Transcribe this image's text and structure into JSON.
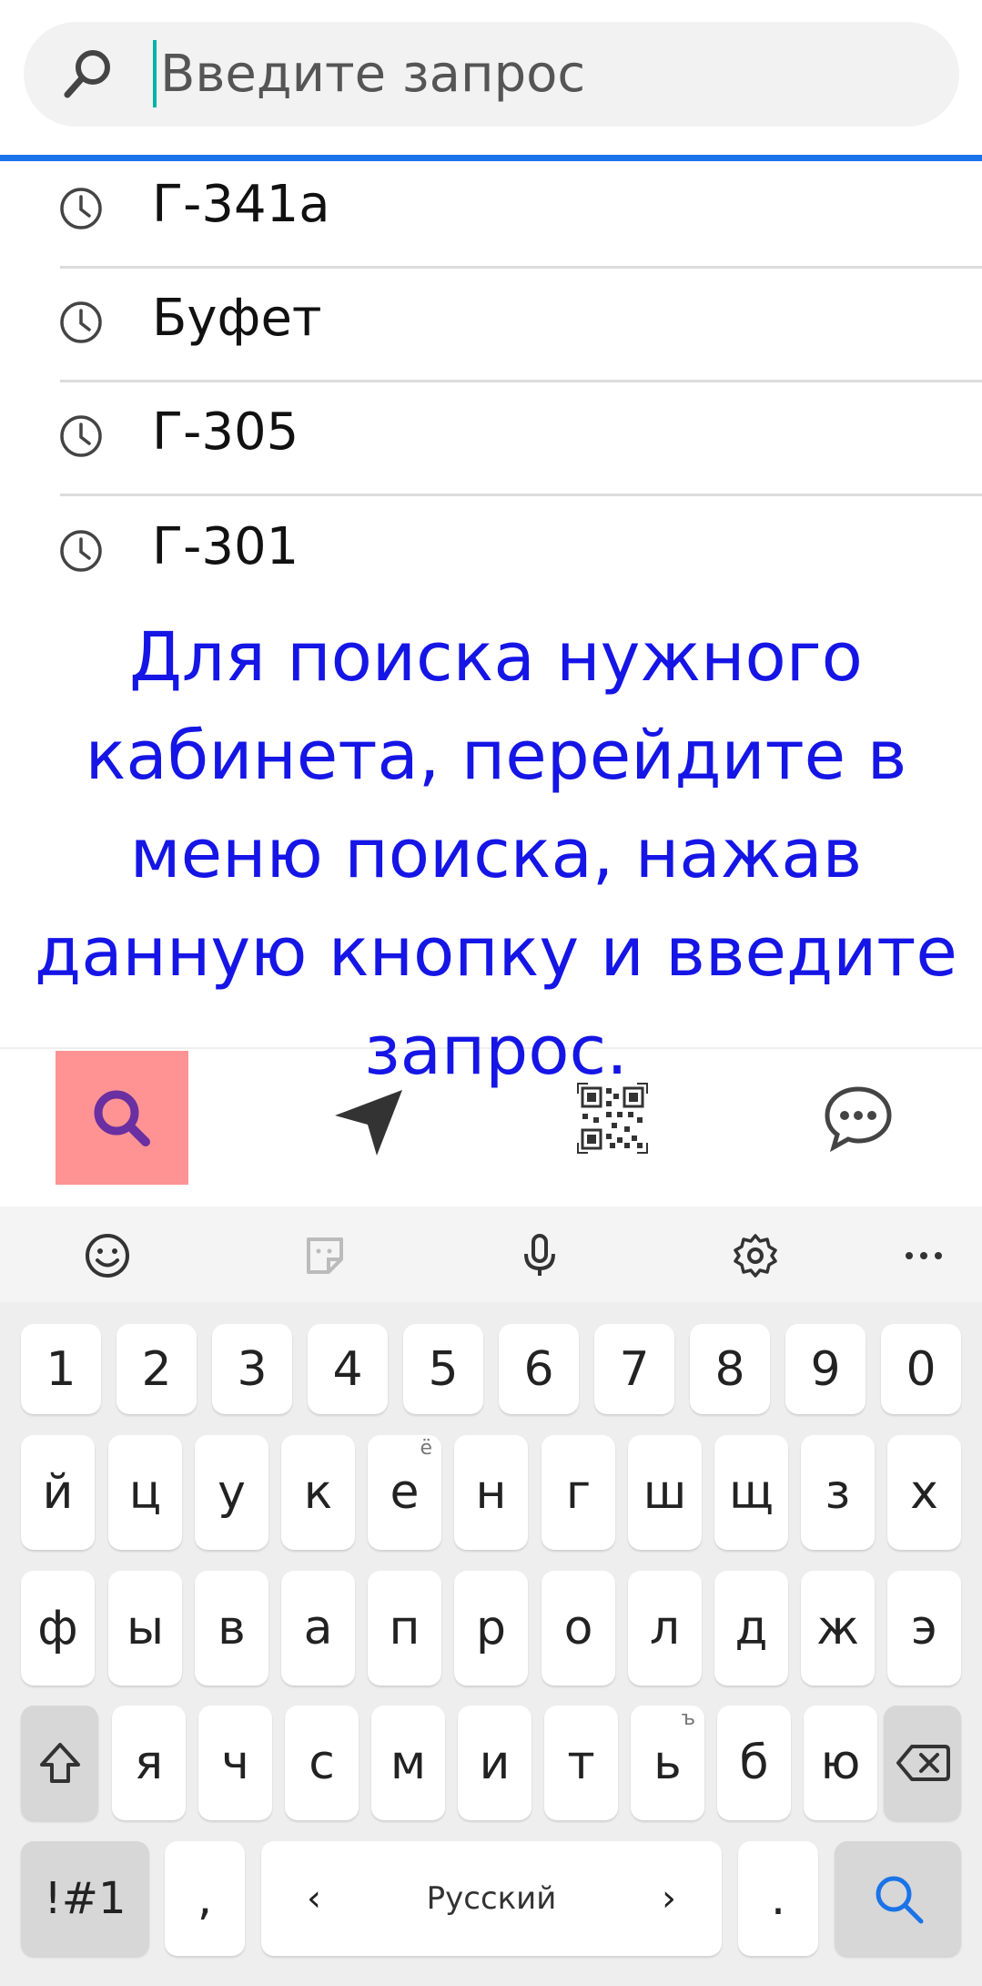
{
  "search": {
    "placeholder": "Введите запрос"
  },
  "history": [
    {
      "label": "Г-341а"
    },
    {
      "label": "Буфет"
    },
    {
      "label": "Г-305"
    },
    {
      "label": "Г-301"
    }
  ],
  "instruction": "Для поиска нужного кабинета, перейдите в меню поиска, нажав данную кнопку и введите запрос.",
  "nav": {
    "items": [
      "search-icon",
      "navigation-arrow-icon",
      "qr-code-icon",
      "chat-icon"
    ],
    "active_highlight": "#ff9393"
  },
  "keyboard": {
    "toolbar_icons": [
      "emoji-icon",
      "sticker-icon",
      "microphone-icon",
      "gear-icon",
      "more-icon"
    ],
    "row_numbers": [
      "1",
      "2",
      "3",
      "4",
      "5",
      "6",
      "7",
      "8",
      "9",
      "0"
    ],
    "row1": [
      "й",
      "ц",
      "у",
      "к",
      "е",
      "н",
      "г",
      "ш",
      "щ",
      "з",
      "х"
    ],
    "row1_hint_e": "ё",
    "row2": [
      "ф",
      "ы",
      "в",
      "а",
      "п",
      "р",
      "о",
      "л",
      "д",
      "ж",
      "э"
    ],
    "row3": [
      "я",
      "ч",
      "с",
      "м",
      "и",
      "т",
      "ь",
      "б",
      "ю"
    ],
    "row3_hint_soft": "ъ",
    "symbols_label": "!#1",
    "comma_label": ",",
    "space_label": "Русский",
    "space_left": "‹",
    "space_right": "›",
    "period_label": "."
  },
  "colors": {
    "accent": "#1a73e8",
    "instruction": "#1515e6",
    "caret": "#00b3a6"
  }
}
